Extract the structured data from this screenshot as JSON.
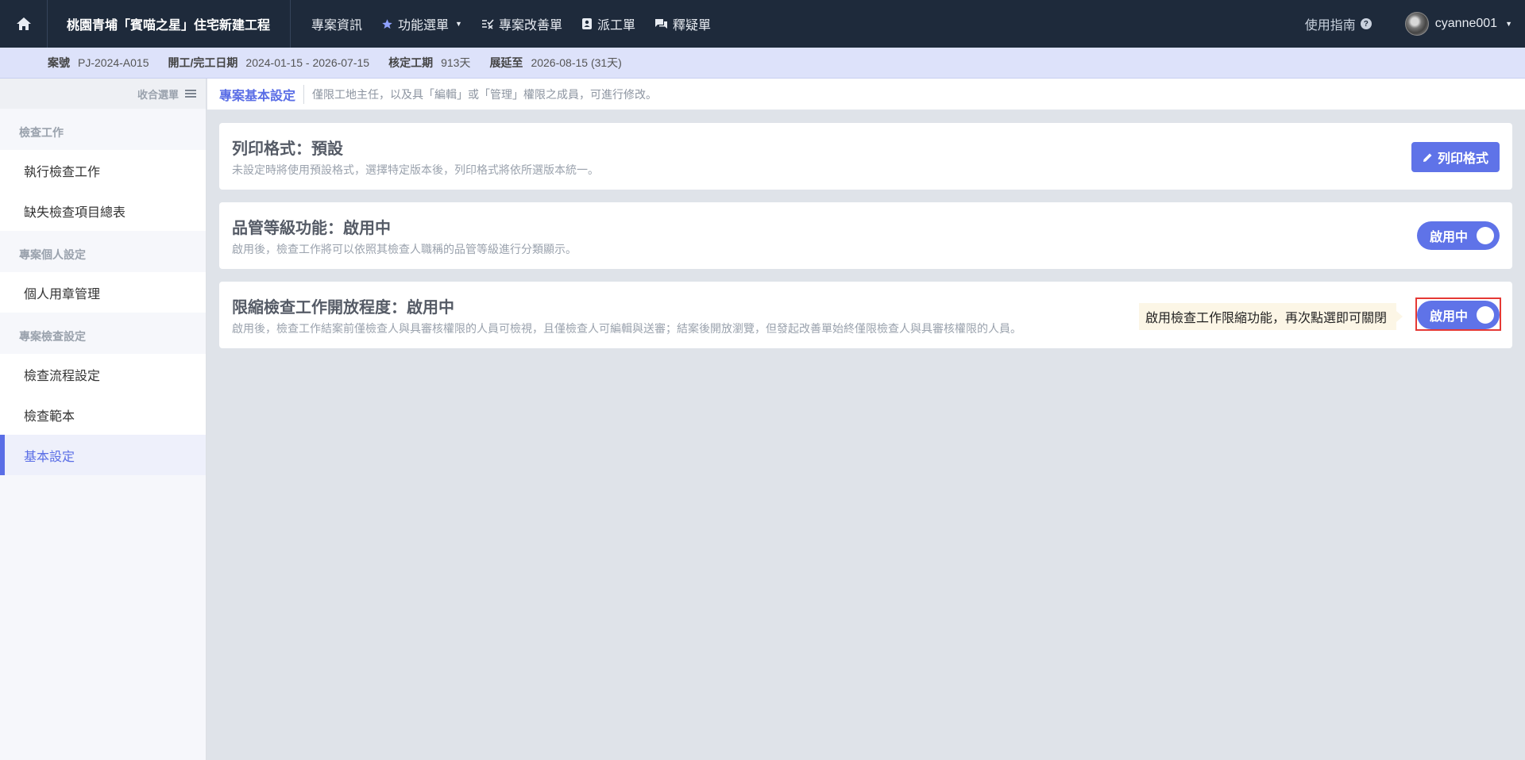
{
  "topnav": {
    "project_title": "桃園青埔「賓喵之星」住宅新建工程",
    "items": [
      {
        "label": "專案資訊",
        "icon": null
      },
      {
        "label": "功能選單",
        "icon": "star-icon",
        "dropdown": true
      },
      {
        "label": "專案改善單",
        "icon": "checklist-icon"
      },
      {
        "label": "派工單",
        "icon": "badge-icon"
      },
      {
        "label": "釋疑單",
        "icon": "chat-icon"
      }
    ],
    "guide_label": "使用指南",
    "username": "cyanne001"
  },
  "infobar": {
    "case_no_label": "案號",
    "case_no": "PJ-2024-A015",
    "dates_label": "開工/完工日期",
    "dates": "2024-01-15 - 2026-07-15",
    "period_label": "核定工期",
    "period": "913天",
    "extend_label": "展延至",
    "extend": "2026-08-15 (31天)"
  },
  "sidebar": {
    "collapse_label": "收合選單",
    "sections": [
      {
        "title": "檢查工作",
        "items": [
          "執行檢查工作",
          "缺失檢查項目總表"
        ]
      },
      {
        "title": "專案個人設定",
        "items": [
          "個人用章管理"
        ]
      },
      {
        "title": "專案檢查設定",
        "items": [
          "檢查流程設定",
          "檢查範本",
          "基本設定"
        ]
      }
    ],
    "active_item": "基本設定"
  },
  "breadcrumb": {
    "title": "專案基本設定",
    "note": "僅限工地主任，以及具「編輯」或「管理」權限之成員，可進行修改。"
  },
  "cards": [
    {
      "title": "列印格式：預設",
      "desc": "未設定時將使用預設格式，選擇特定版本後，列印格式將依所選版本統一。",
      "button_label": "列印格式"
    },
    {
      "title": "品管等級功能：啟用中",
      "desc": "啟用後，檢查工作將可以依照其檢查人職稱的品管等級進行分類顯示。",
      "toggle_label": "啟用中",
      "toggle_on": true
    },
    {
      "title": "限縮檢查工作開放程度：啟用中",
      "desc": "啟用後，檢查工作結案前僅檢查人與具審核權限的人員可檢視，且僅檢查人可編輯與送審；結案後開放瀏覽，但發起改善單始終僅限檢查人與具審核權限的人員。",
      "toggle_label": "啟用中",
      "toggle_on": true
    }
  ],
  "tooltip": "啟用檢查工作限縮功能，再次點選即可關閉",
  "colors": {
    "nav_bg": "#1e2a3b",
    "accent": "#5f73e8",
    "infobar_bg": "#dde2fa",
    "highlight": "#e53935"
  }
}
